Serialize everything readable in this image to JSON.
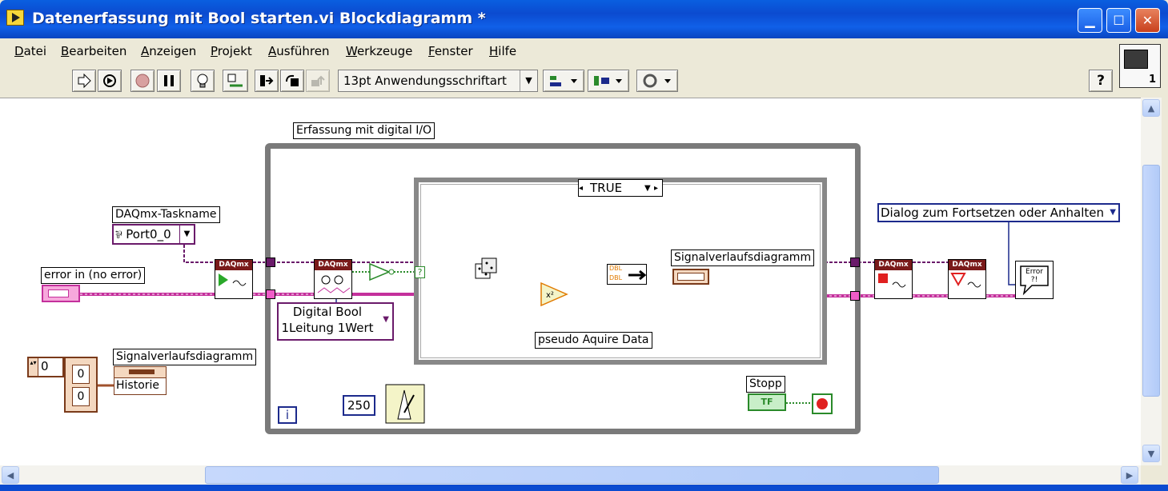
{
  "window": {
    "title": "Datenerfassung mit Bool starten.vi Blockdiagramm *"
  },
  "menu": {
    "items": [
      "Datei",
      "Bearbeiten",
      "Anzeigen",
      "Projekt",
      "Ausführen",
      "Werkzeuge",
      "Fenster",
      "Hilfe"
    ]
  },
  "toolbar": {
    "font_select": "13pt Anwendungsschriftart",
    "help_label": "?",
    "vi_icon_number": "1"
  },
  "diagram": {
    "while_loop_label": "Erfassung mit digital I/O",
    "loop_iteration_label": "i",
    "case_selector_value": "TRUE",
    "case_question": "?",
    "task_name_label": "DAQmx-Taskname",
    "task_name_value": "Port0_0",
    "error_in_label": "error in (no error)",
    "digital_bool_line1": "Digital Bool",
    "digital_bool_line2": "1Leitung 1Wert",
    "chart_label_left": "Signalverlaufsdiagramm",
    "chart_history_value": "Historie",
    "array_index_value": "0",
    "array_elem_1": "0",
    "array_elem_2": "0",
    "chart_label_inner": "Signalverlaufsdiagramm",
    "pseudo_label": "pseudo Aquire Data",
    "wait_constant": "250",
    "stop_label": "Stopp",
    "stop_terminal": "TF",
    "dialog_label": "Dialog zum Fortsetzen oder Anhalten",
    "daqmx_header": "DAQmx",
    "error_dialog_text": "Error ?!",
    "dbl_label": "DBL"
  },
  "colors": {
    "titlebar": "#0b4bd0",
    "error_wire": "#c4309c",
    "task_wire": "#6a1a6a",
    "dbl_wire": "#e07a00",
    "loop_frame": "#7a7a7a",
    "bool_wire": "#2a8a2a",
    "enum_border": "#1c2a8c"
  }
}
